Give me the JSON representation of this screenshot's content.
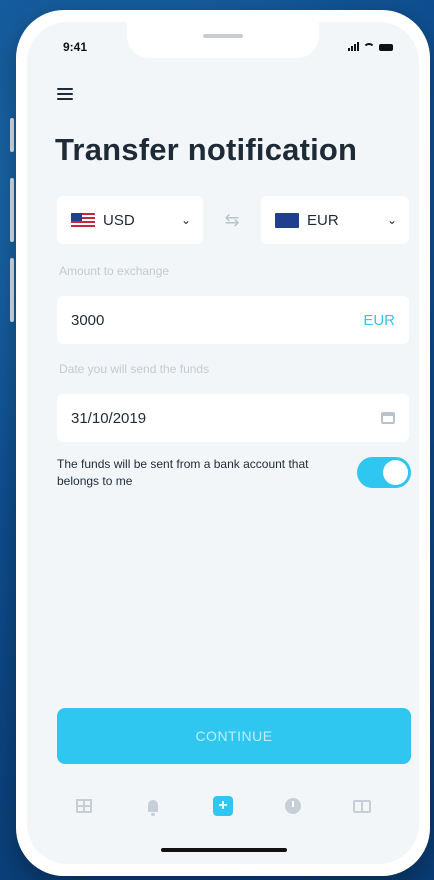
{
  "status_bar": {
    "time": "9:41"
  },
  "page": {
    "title": "Transfer notification"
  },
  "exchange": {
    "from": {
      "code": "USD",
      "flag_icon": "us-flag-icon"
    },
    "to": {
      "code": "EUR",
      "flag_icon": "eu-flag-icon"
    }
  },
  "amount": {
    "label": "Amount to exchange",
    "value": "3000",
    "currency": "EUR"
  },
  "send_date": {
    "label": "Date you will send the funds",
    "value": "31/10/2019"
  },
  "ownership": {
    "text": "The funds will be sent from a bank account that belongs to me",
    "enabled": true
  },
  "actions": {
    "continue_label": "CONTINUE"
  },
  "tabbar": {
    "items": [
      {
        "icon": "grid-icon"
      },
      {
        "icon": "bell-icon"
      },
      {
        "icon": "plus-icon",
        "active": true
      },
      {
        "icon": "clock-icon"
      },
      {
        "icon": "card-icon"
      }
    ]
  },
  "colors": {
    "accent": "#2fc6f0",
    "text": "#1f2a37",
    "background": "#0f4f91"
  }
}
